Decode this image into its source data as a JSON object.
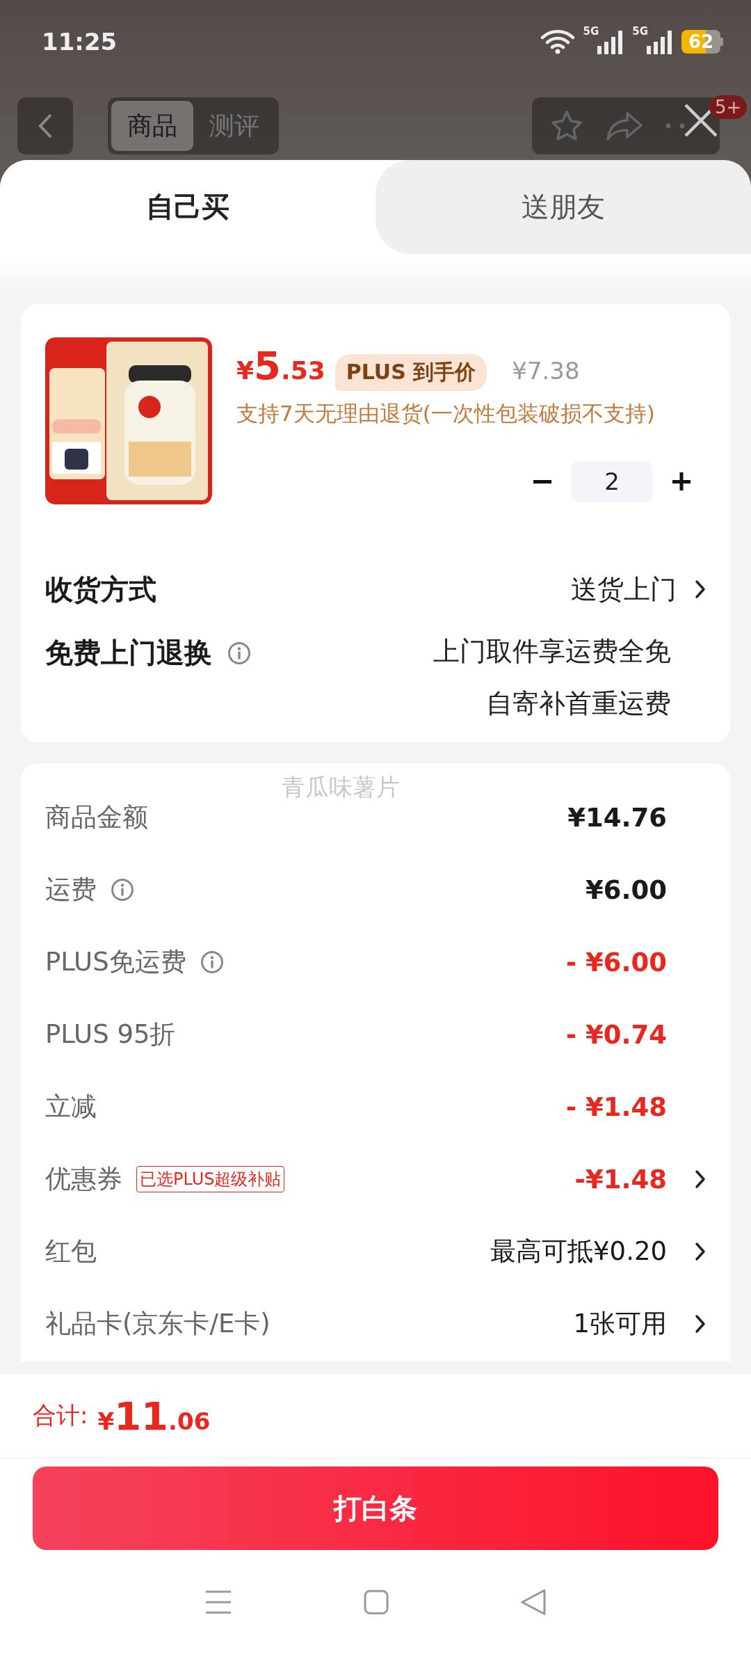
{
  "status_bar": {
    "time": "11:25",
    "network_labels": [
      "5G",
      "5G"
    ],
    "battery": "62"
  },
  "header": {
    "segments": [
      {
        "label": "商品",
        "selected": true
      },
      {
        "label": "测评",
        "selected": false
      }
    ],
    "badge": "5+"
  },
  "tabs": [
    {
      "label": "自己买",
      "selected": true
    },
    {
      "label": "送朋友",
      "selected": false
    }
  ],
  "product": {
    "price_symbol": "¥",
    "price_int": "5",
    "price_dec": ".53",
    "plus_label": "PLUS 到手价",
    "original_price": "¥7.38",
    "return_policy": "支持7天无理由退货(一次性包装破损不支持)",
    "quantity": "2"
  },
  "delivery": {
    "label": "收货方式",
    "value": "送货上门"
  },
  "return_service": {
    "label": "免费上门退换",
    "lines": [
      "上门取件享运费全免",
      "自寄补首重运费"
    ]
  },
  "ghost_text": "青瓜味薯片",
  "fees": [
    {
      "label": "商品金额",
      "value": "¥14.76",
      "kind": "amount",
      "info": false,
      "arrow": false
    },
    {
      "label": "运费",
      "value": "¥6.00",
      "kind": "amount",
      "info": true,
      "arrow": false
    },
    {
      "label": "PLUS免运费",
      "value": "- ¥6.00",
      "kind": "discount",
      "info": true,
      "arrow": false
    },
    {
      "label": "PLUS 95折",
      "value": "- ¥0.74",
      "kind": "discount",
      "info": false,
      "arrow": false
    },
    {
      "label": "立减",
      "value": "- ¥1.48",
      "kind": "discount",
      "info": false,
      "arrow": false
    },
    {
      "label": "优惠券",
      "tag": "已选PLUS超级补贴",
      "value": "-¥1.48",
      "kind": "discount",
      "info": false,
      "arrow": true
    },
    {
      "label": "红包",
      "value": "最高可抵¥0.20",
      "kind": "text",
      "info": false,
      "arrow": true
    },
    {
      "label": "礼品卡(京东卡/E卡)",
      "value": "1张可用",
      "kind": "text",
      "info": false,
      "arrow": true
    }
  ],
  "total": {
    "label": "合计:",
    "symbol": "¥",
    "int": "11",
    "dec": ".06"
  },
  "pay_button": "打白条"
}
